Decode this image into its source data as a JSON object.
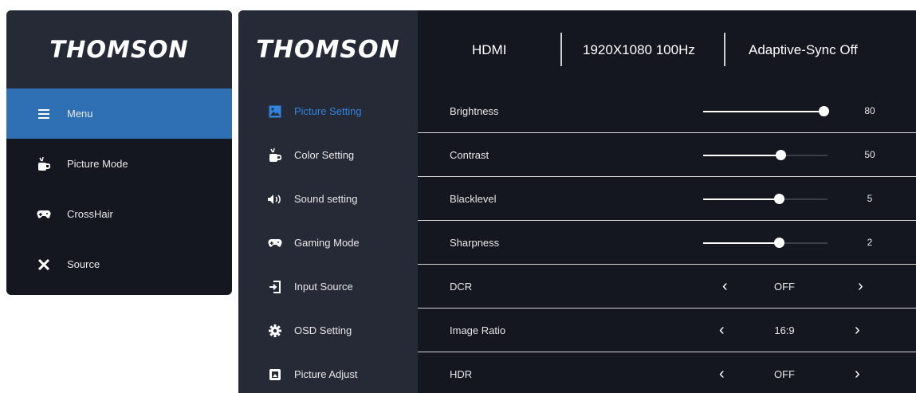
{
  "brand": "THOMSON",
  "quick_menu": {
    "items": [
      {
        "label": "Menu",
        "icon": "menu-icon",
        "active": true
      },
      {
        "label": "Picture Mode",
        "icon": "cup-icon",
        "active": false
      },
      {
        "label": "CrossHair",
        "icon": "gamepad-icon",
        "active": false
      },
      {
        "label": "Source",
        "icon": "source-icon",
        "active": false
      }
    ]
  },
  "status_bar": {
    "input": "HDMI",
    "resolution": "1920X1080 100Hz",
    "adaptive_sync": "Adaptive-Sync Off"
  },
  "nav": {
    "items": [
      {
        "label": "Picture Setting",
        "icon": "picture-icon",
        "active": true
      },
      {
        "label": "Color Setting",
        "icon": "cup-icon",
        "active": false
      },
      {
        "label": "Sound setting",
        "icon": "speaker-icon",
        "active": false
      },
      {
        "label": "Gaming Mode",
        "icon": "gamepad-icon",
        "active": false
      },
      {
        "label": "Input Source",
        "icon": "input-icon",
        "active": false
      },
      {
        "label": "OSD Setting",
        "icon": "gear-icon",
        "active": false
      },
      {
        "label": "Picture Adjust",
        "icon": "adjust-icon",
        "active": false
      }
    ]
  },
  "settings": {
    "brightness": {
      "label": "Brightness",
      "value": "80",
      "level": 0.97
    },
    "contrast": {
      "label": "Contrast",
      "value": "50",
      "level": 0.62
    },
    "blacklevel": {
      "label": "Blacklevel",
      "value": "5",
      "level": 0.61
    },
    "sharpness": {
      "label": "Sharpness",
      "value": "2",
      "level": 0.61
    },
    "dcr": {
      "label": "DCR",
      "value": "OFF"
    },
    "image_ratio": {
      "label": "Image Ratio",
      "value": "16:9"
    },
    "hdr": {
      "label": "HDR",
      "value": "OFF"
    }
  },
  "arrows": {
    "left": "‹",
    "right": "›"
  },
  "colors": {
    "accent": "#2f6fb4",
    "accent_text": "#2f84e0",
    "panel": "#141620",
    "panel_light": "#262a36"
  }
}
